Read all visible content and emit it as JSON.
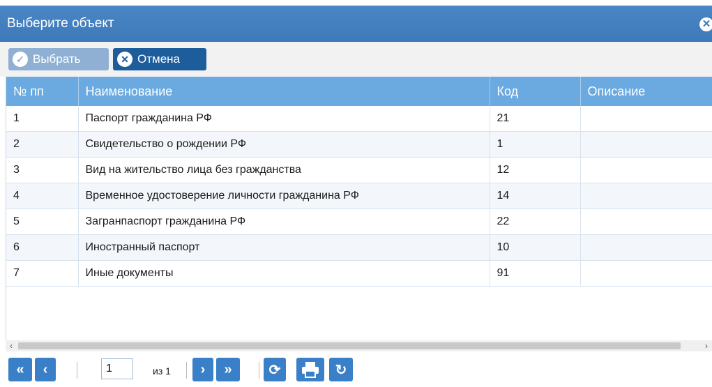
{
  "dialog": {
    "title": "Выберите объект"
  },
  "toolbar": {
    "select_label": "Выбрать",
    "cancel_label": "Отмена"
  },
  "table": {
    "columns": [
      "№ пп",
      "Наименование",
      "Код",
      "Описание"
    ],
    "rows": [
      {
        "n": "1",
        "name": "Паспорт гражданина РФ",
        "code": "21",
        "desc": ""
      },
      {
        "n": "2",
        "name": "Свидетельство о рождении РФ",
        "code": "1",
        "desc": ""
      },
      {
        "n": "3",
        "name": "Вид на жительство лица без гражданства",
        "code": "12",
        "desc": ""
      },
      {
        "n": "4",
        "name": "Временное удостоверение личности гражданина РФ",
        "code": "14",
        "desc": ""
      },
      {
        "n": "5",
        "name": "Загранпаспорт гражданина РФ",
        "code": "22",
        "desc": ""
      },
      {
        "n": "6",
        "name": "Иностранный паспорт",
        "code": "10",
        "desc": ""
      },
      {
        "n": "7",
        "name": "Иные документы",
        "code": "91",
        "desc": ""
      }
    ]
  },
  "pager": {
    "page": "1",
    "of_label": "из 1"
  },
  "icons": {
    "close": "close-icon",
    "check": "check-circle-icon",
    "cancel": "cancel-circle-icon",
    "first": "first-page-icon",
    "prev": "prev-page-icon",
    "next": "next-page-icon",
    "last": "last-page-icon",
    "refresh": "refresh-icon",
    "print": "print-icon",
    "reload": "reload-icon"
  },
  "colors": {
    "header": "#3e7ab9",
    "table_header": "#6aaae0",
    "button_primary": "#1d5d9b",
    "button_disabled": "#8fb0d2"
  }
}
